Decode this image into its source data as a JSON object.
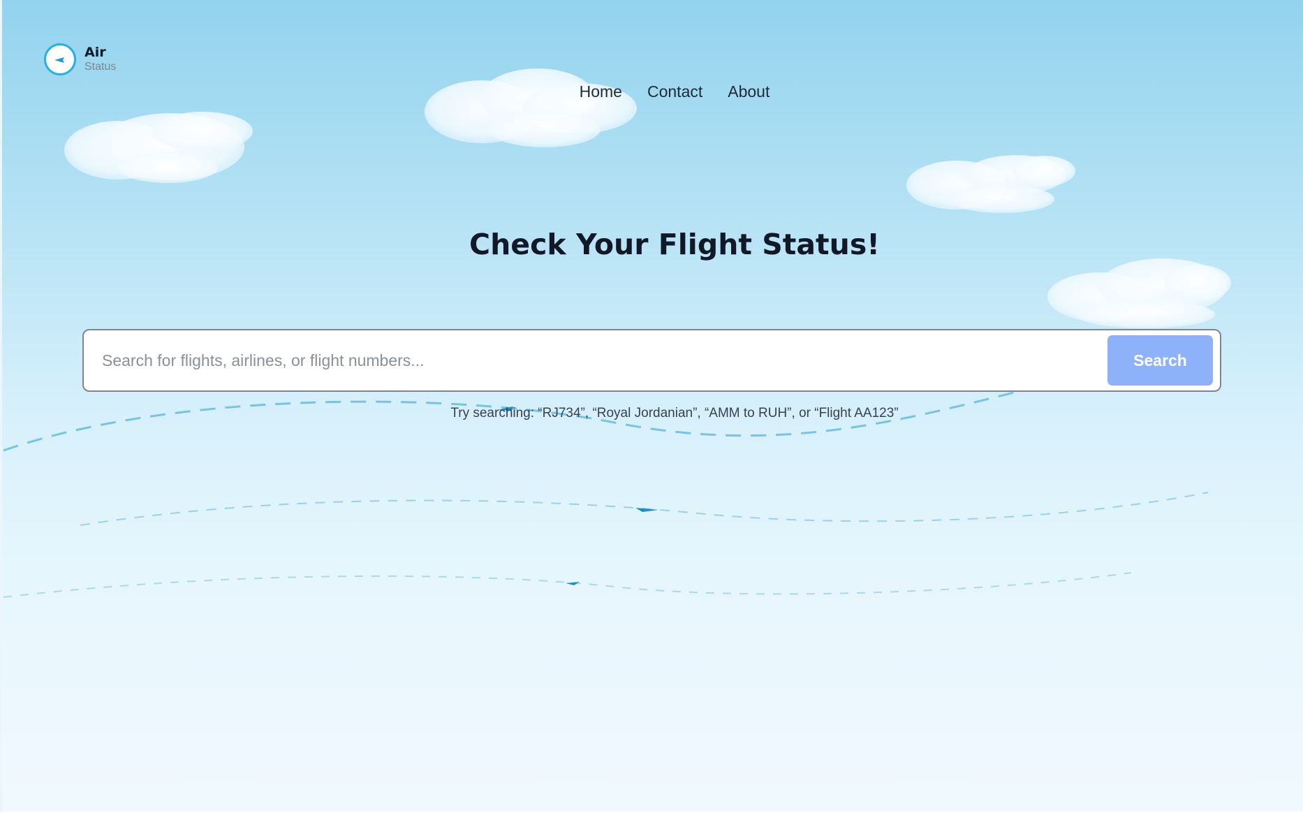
{
  "brand": {
    "name": "Air",
    "tagline": "Status"
  },
  "nav": {
    "items": [
      {
        "label": "Home"
      },
      {
        "label": "Contact"
      },
      {
        "label": "About"
      }
    ]
  },
  "hero": {
    "title": "Check Your Flight Status!"
  },
  "search": {
    "placeholder": "Search for flights, airlines, or flight numbers...",
    "value": "",
    "button_label": "Search",
    "hint": "Try searching: “RJ734”, “Royal Jordanian”, “AMM to RUH”, or “Flight AA123”"
  },
  "colors": {
    "accent": "#27b1e3",
    "button": "#8eb2f9",
    "sky_top": "#93d3ee",
    "sky_bottom": "#f1f9fe"
  },
  "icons": {
    "logo": "airplane-clock-icon",
    "decor": [
      "cloud",
      "airplane",
      "dashed-flight-path"
    ]
  }
}
